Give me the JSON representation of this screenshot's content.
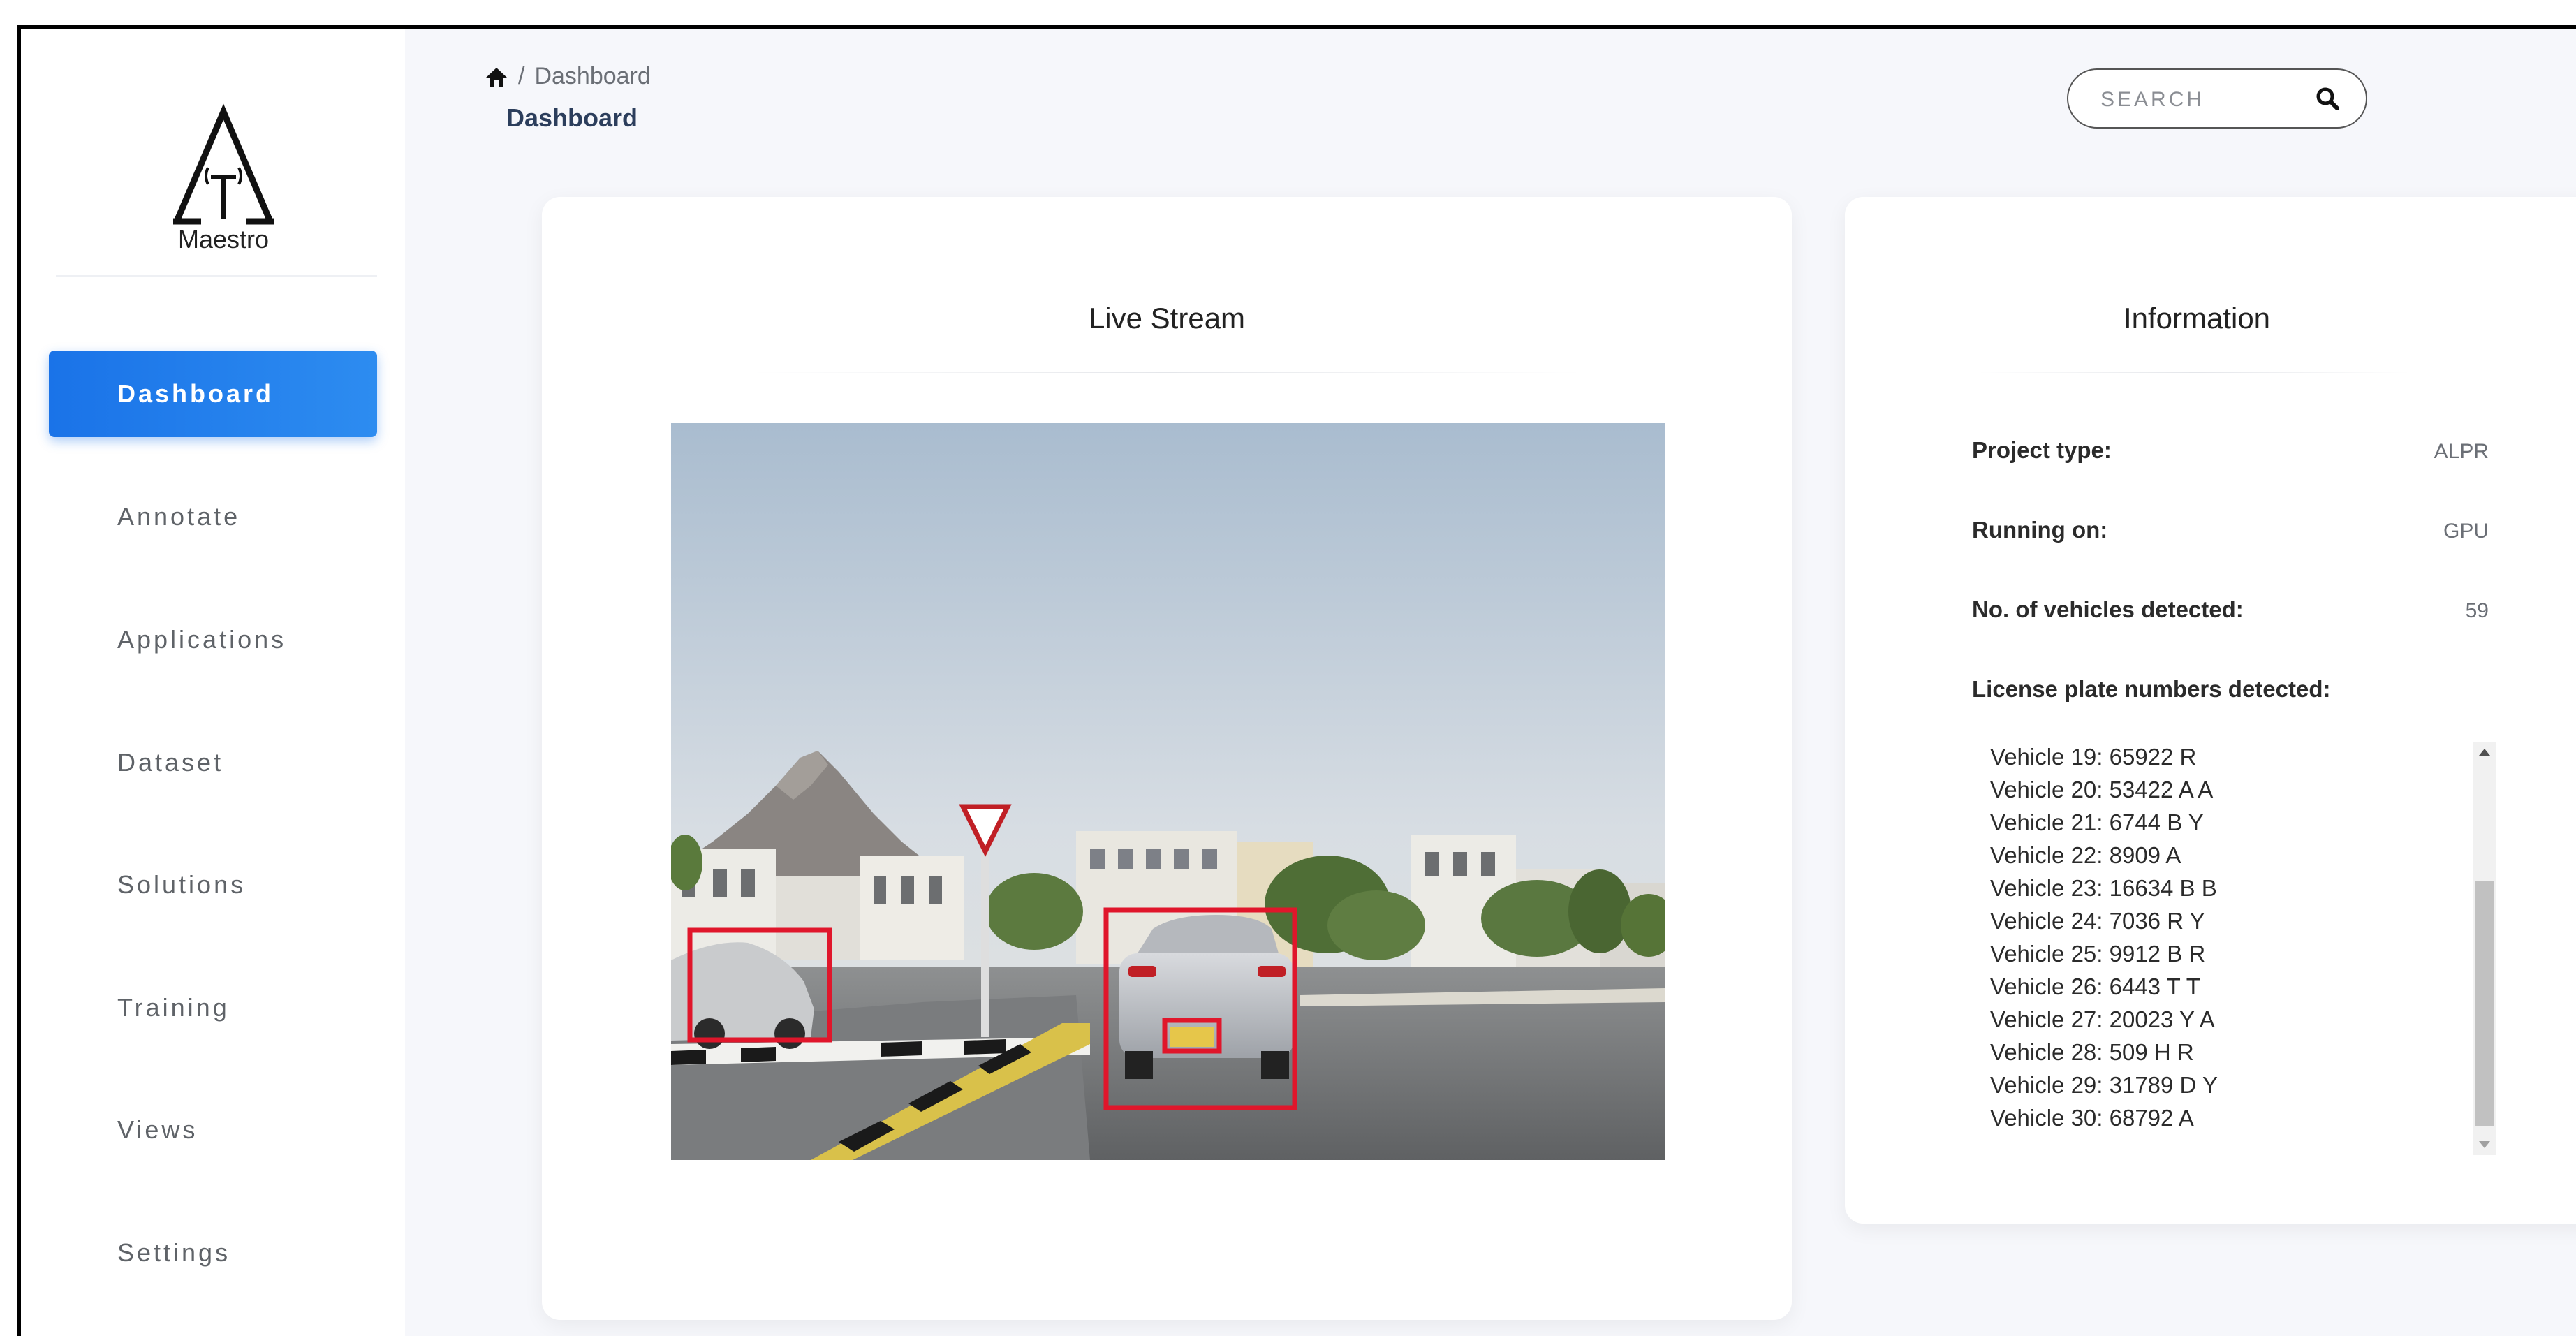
{
  "app": {
    "logo_text": "Maestro"
  },
  "sidebar": {
    "items": [
      {
        "label": "Dashboard",
        "active": true
      },
      {
        "label": "Annotate"
      },
      {
        "label": "Applications"
      },
      {
        "label": "Dataset"
      },
      {
        "label": "Solutions"
      },
      {
        "label": "Training"
      },
      {
        "label": "Views"
      },
      {
        "label": "Settings"
      }
    ]
  },
  "header": {
    "breadcrumb_separator": "/",
    "breadcrumb_current": "Dashboard",
    "title": "Dashboard",
    "search_placeholder": "SEARCH"
  },
  "stream_card": {
    "title": "Live Stream"
  },
  "info_card": {
    "title": "Information",
    "project_type_label": "Project type:",
    "project_type_value": "ALPR",
    "running_on_label": "Running on:",
    "running_on_value": "GPU",
    "vehicles_label": "No. of vehicles detected:",
    "vehicles_value": "59",
    "plates_label": "License plate numbers detected:",
    "plates": [
      "Vehicle 19: 65922 R",
      "Vehicle 20: 53422 A A",
      "Vehicle 21: 6744 B Y",
      "Vehicle 22: 8909 A",
      "Vehicle 23: 16634 B B",
      "Vehicle 24: 7036 R Y",
      "Vehicle 25: 9912 B R",
      "Vehicle 26: 6443 T T",
      "Vehicle 27: 20023 Y A",
      "Vehicle 28: 509 H R",
      "Vehicle 29: 31789 D Y",
      "Vehicle 30: 68792 A"
    ]
  },
  "colors": {
    "accent": "#1a73e8",
    "detection_box": "#e0162b"
  }
}
